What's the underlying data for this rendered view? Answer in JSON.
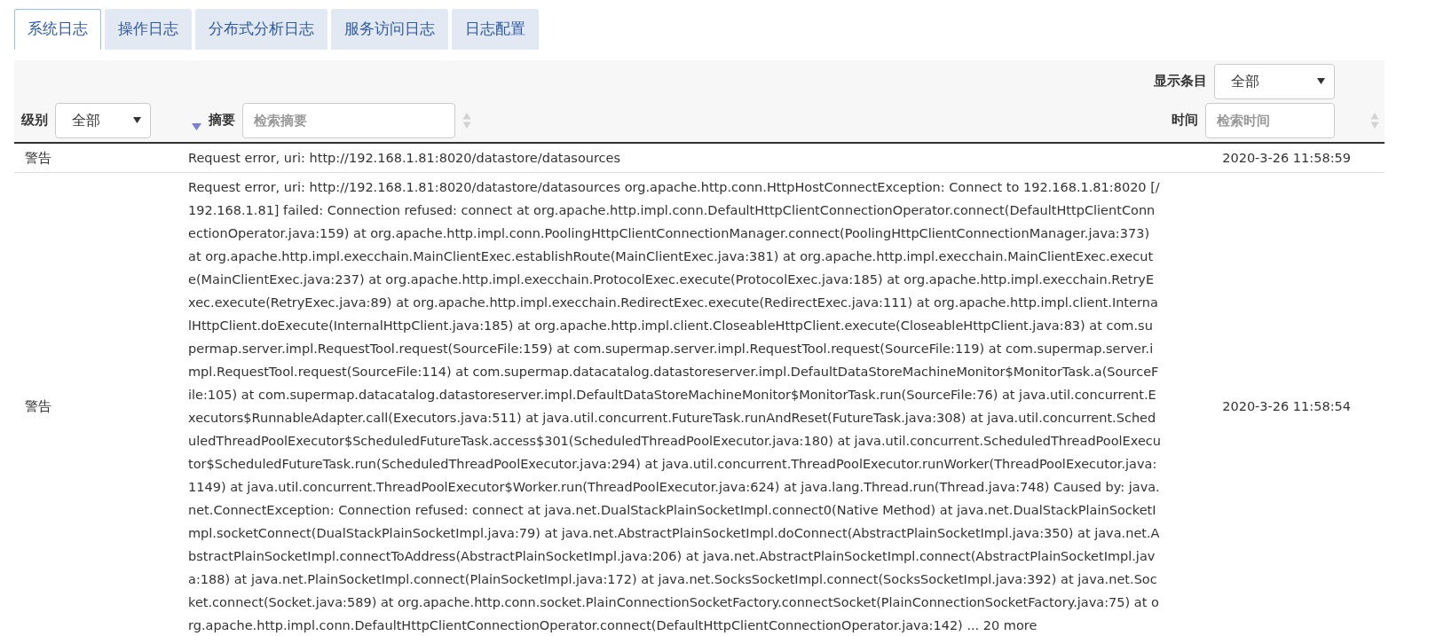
{
  "tabs": [
    {
      "label": "系统日志",
      "selected": true
    },
    {
      "label": "操作日志",
      "selected": false
    },
    {
      "label": "分布式分析日志",
      "selected": false
    },
    {
      "label": "服务访问日志",
      "selected": false
    },
    {
      "label": "日志配置",
      "selected": false
    }
  ],
  "page_size": {
    "label": "显示条目",
    "value": "全部"
  },
  "columns": [
    {
      "kind": "select",
      "label": "级别",
      "value": "全部"
    },
    {
      "kind": "search",
      "label": "摘要",
      "placeholder": "检索摘要"
    },
    {
      "kind": "search",
      "label": "时间",
      "placeholder": "检索时间"
    }
  ],
  "rows": [
    {
      "level": "警告",
      "summary": "Request error, uri: http://192.168.1.81:8020/datastore/datasources",
      "time": "2020-3-26 11:58:59"
    },
    {
      "level": "警告",
      "summary": "Request error, uri: http://192.168.1.81:8020/datastore/datasources org.apache.http.conn.HttpHostConnectException: Connect to 192.168.1.81:8020 [/192.168.1.81] failed: Connection refused: connect at org.apache.http.impl.conn.DefaultHttpClientConnectionOperator.connect(DefaultHttpClientConnectionOperator.java:159) at org.apache.http.impl.conn.PoolingHttpClientConnectionManager.connect(PoolingHttpClientConnectionManager.java:373) at org.apache.http.impl.execchain.MainClientExec.establishRoute(MainClientExec.java:381) at org.apache.http.impl.execchain.MainClientExec.execute(MainClientExec.java:237) at org.apache.http.impl.execchain.ProtocolExec.execute(ProtocolExec.java:185) at org.apache.http.impl.execchain.RetryExec.execute(RetryExec.java:89) at org.apache.http.impl.execchain.RedirectExec.execute(RedirectExec.java:111) at org.apache.http.impl.client.InternalHttpClient.doExecute(InternalHttpClient.java:185) at org.apache.http.impl.client.CloseableHttpClient.execute(CloseableHttpClient.java:83) at com.supermap.server.impl.RequestTool.request(SourceFile:159) at com.supermap.server.impl.RequestTool.request(SourceFile:119) at com.supermap.server.impl.RequestTool.request(SourceFile:114) at com.supermap.datacatalog.datastoreserver.impl.DefaultDataStoreMachineMonitor$MonitorTask.a(SourceFile:105) at com.supermap.datacatalog.datastoreserver.impl.DefaultDataStoreMachineMonitor$MonitorTask.run(SourceFile:76) at java.util.concurrent.Executors$RunnableAdapter.call(Executors.java:511) at java.util.concurrent.FutureTask.runAndReset(FutureTask.java:308) at java.util.concurrent.ScheduledThreadPoolExecutor$ScheduledFutureTask.access$301(ScheduledThreadPoolExecutor.java:180) at java.util.concurrent.ScheduledThreadPoolExecutor$ScheduledFutureTask.run(ScheduledThreadPoolExecutor.java:294) at java.util.concurrent.ThreadPoolExecutor.runWorker(ThreadPoolExecutor.java:1149) at java.util.concurrent.ThreadPoolExecutor$Worker.run(ThreadPoolExecutor.java:624) at java.lang.Thread.run(Thread.java:748) Caused by: java.net.ConnectException: Connection refused: connect at java.net.DualStackPlainSocketImpl.connect0(Native Method) at java.net.DualStackPlainSocketImpl.socketConnect(DualStackPlainSocketImpl.java:79) at java.net.AbstractPlainSocketImpl.doConnect(AbstractPlainSocketImpl.java:350) at java.net.AbstractPlainSocketImpl.connectToAddress(AbstractPlainSocketImpl.java:206) at java.net.AbstractPlainSocketImpl.connect(AbstractPlainSocketImpl.java:188) at java.net.PlainSocketImpl.connect(PlainSocketImpl.java:172) at java.net.SocksSocketImpl.connect(SocksSocketImpl.java:392) at java.net.Socket.connect(Socket.java:589) at org.apache.http.conn.socket.PlainConnectionSocketFactory.connectSocket(PlainConnectionSocketFactory.java:75) at org.apache.http.impl.conn.DefaultHttpClientConnectionOperator.connect(DefaultHttpClientConnectionOperator.java:142) ... 20 more",
      "time": "2020-3-26 11:58:54"
    }
  ]
}
